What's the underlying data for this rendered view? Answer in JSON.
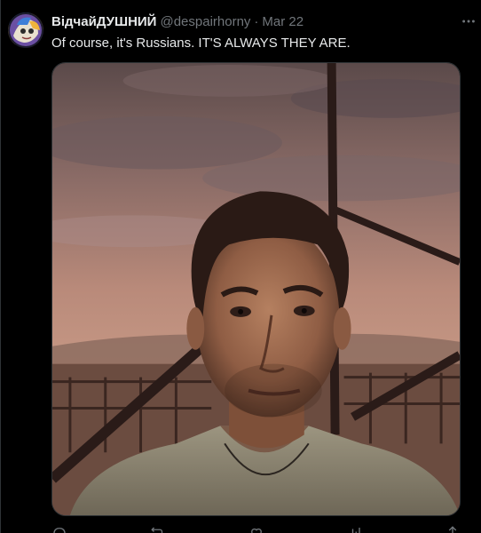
{
  "tweet": {
    "display_name": "ВідчайДУШНИЙ",
    "handle": "@despairhorny",
    "separator": "·",
    "date": "Mar 22",
    "text": "Of course, it's Russians. IT'S ALWAYS THEY ARE.",
    "avatar_icon": "avatar-image",
    "more_icon": "more-icon",
    "media_description_icon": "photo-media"
  },
  "colors": {
    "background": "#000000",
    "text_primary": "#e7e9ea",
    "text_secondary": "#71767b",
    "border": "#2f3336"
  },
  "actions": [
    {
      "icon": "reply-icon"
    },
    {
      "icon": "repost-icon"
    },
    {
      "icon": "like-icon"
    },
    {
      "icon": "views-icon"
    },
    {
      "icon": "share-icon"
    }
  ]
}
